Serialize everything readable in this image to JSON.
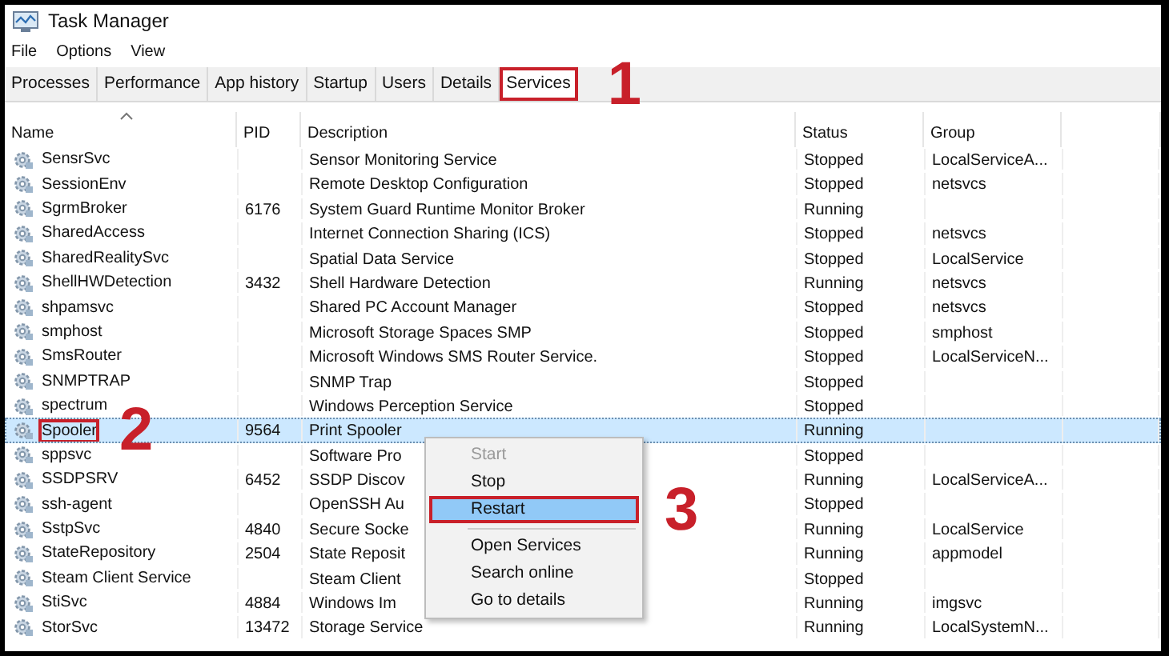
{
  "window": {
    "title": "Task Manager"
  },
  "menu": [
    "File",
    "Options",
    "View"
  ],
  "tabs": [
    {
      "label": "Processes",
      "selected": false
    },
    {
      "label": "Performance",
      "selected": false
    },
    {
      "label": "App history",
      "selected": false
    },
    {
      "label": "Startup",
      "selected": false
    },
    {
      "label": "Users",
      "selected": false
    },
    {
      "label": "Details",
      "selected": false
    },
    {
      "label": "Services",
      "selected": true,
      "annotation": "1"
    }
  ],
  "table": {
    "columns": [
      {
        "label": "Name",
        "sorted": true
      },
      {
        "label": "PID",
        "sorted": false
      },
      {
        "label": "Description",
        "sorted": false
      },
      {
        "label": "Status",
        "sorted": false
      },
      {
        "label": "Group",
        "sorted": false
      }
    ],
    "rows": [
      {
        "name": "SensrSvc",
        "pid": "",
        "description": "Sensor Monitoring Service",
        "status": "Stopped",
        "group": "LocalServiceA...",
        "selected": false
      },
      {
        "name": "SessionEnv",
        "pid": "",
        "description": "Remote Desktop Configuration",
        "status": "Stopped",
        "group": "netsvcs",
        "selected": false
      },
      {
        "name": "SgrmBroker",
        "pid": "6176",
        "description": "System Guard Runtime Monitor Broker",
        "status": "Running",
        "group": "",
        "selected": false
      },
      {
        "name": "SharedAccess",
        "pid": "",
        "description": "Internet Connection Sharing (ICS)",
        "status": "Stopped",
        "group": "netsvcs",
        "selected": false
      },
      {
        "name": "SharedRealitySvc",
        "pid": "",
        "description": "Spatial Data Service",
        "status": "Stopped",
        "group": "LocalService",
        "selected": false
      },
      {
        "name": "ShellHWDetection",
        "pid": "3432",
        "description": "Shell Hardware Detection",
        "status": "Running",
        "group": "netsvcs",
        "selected": false
      },
      {
        "name": "shpamsvc",
        "pid": "",
        "description": "Shared PC Account Manager",
        "status": "Stopped",
        "group": "netsvcs",
        "selected": false
      },
      {
        "name": "smphost",
        "pid": "",
        "description": "Microsoft Storage Spaces SMP",
        "status": "Stopped",
        "group": "smphost",
        "selected": false
      },
      {
        "name": "SmsRouter",
        "pid": "",
        "description": "Microsoft Windows SMS Router Service.",
        "status": "Stopped",
        "group": "LocalServiceN...",
        "selected": false
      },
      {
        "name": "SNMPTRAP",
        "pid": "",
        "description": "SNMP Trap",
        "status": "Stopped",
        "group": "",
        "selected": false
      },
      {
        "name": "spectrum",
        "pid": "",
        "description": "Windows Perception Service",
        "status": "Stopped",
        "group": "",
        "selected": false
      },
      {
        "name": "Spooler",
        "pid": "9564",
        "description": "Print Spooler",
        "status": "Running",
        "group": "",
        "selected": true,
        "annotation": "2"
      },
      {
        "name": "sppsvc",
        "pid": "",
        "description": "Software Pro",
        "status": "Stopped",
        "group": "",
        "selected": false
      },
      {
        "name": "SSDPSRV",
        "pid": "6452",
        "description": "SSDP Discov",
        "status": "Running",
        "group": "LocalServiceA...",
        "selected": false
      },
      {
        "name": "ssh-agent",
        "pid": "",
        "description": "OpenSSH Au",
        "status": "Stopped",
        "group": "",
        "selected": false
      },
      {
        "name": "SstpSvc",
        "pid": "4840",
        "description": "Secure Socke",
        "status": "Running",
        "group": "LocalService",
        "selected": false
      },
      {
        "name": "StateRepository",
        "pid": "2504",
        "description": "State Reposit",
        "status": "Running",
        "group": "appmodel",
        "selected": false
      },
      {
        "name": "Steam Client Service",
        "pid": "",
        "description": "Steam Client",
        "status": "Stopped",
        "group": "",
        "selected": false
      },
      {
        "name": "StiSvc",
        "pid": "4884",
        "description": "Windows Im",
        "status": "Running",
        "group": "imgsvc",
        "selected": false
      },
      {
        "name": "StorSvc",
        "pid": "13472",
        "description": "Storage Service",
        "status": "Running",
        "group": "LocalSystemN...",
        "selected": false
      }
    ]
  },
  "context_menu": {
    "items": [
      {
        "kind": "item",
        "label": "Start",
        "disabled": true,
        "hovered": false
      },
      {
        "kind": "item",
        "label": "Stop",
        "disabled": false,
        "hovered": false
      },
      {
        "kind": "item",
        "label": "Restart",
        "disabled": false,
        "hovered": true,
        "annotation": "3"
      },
      {
        "kind": "separator"
      },
      {
        "kind": "item",
        "label": "Open Services",
        "disabled": false,
        "hovered": false
      },
      {
        "kind": "item",
        "label": "Search online",
        "disabled": false,
        "hovered": false
      },
      {
        "kind": "item",
        "label": "Go to details",
        "disabled": false,
        "hovered": false
      }
    ]
  }
}
